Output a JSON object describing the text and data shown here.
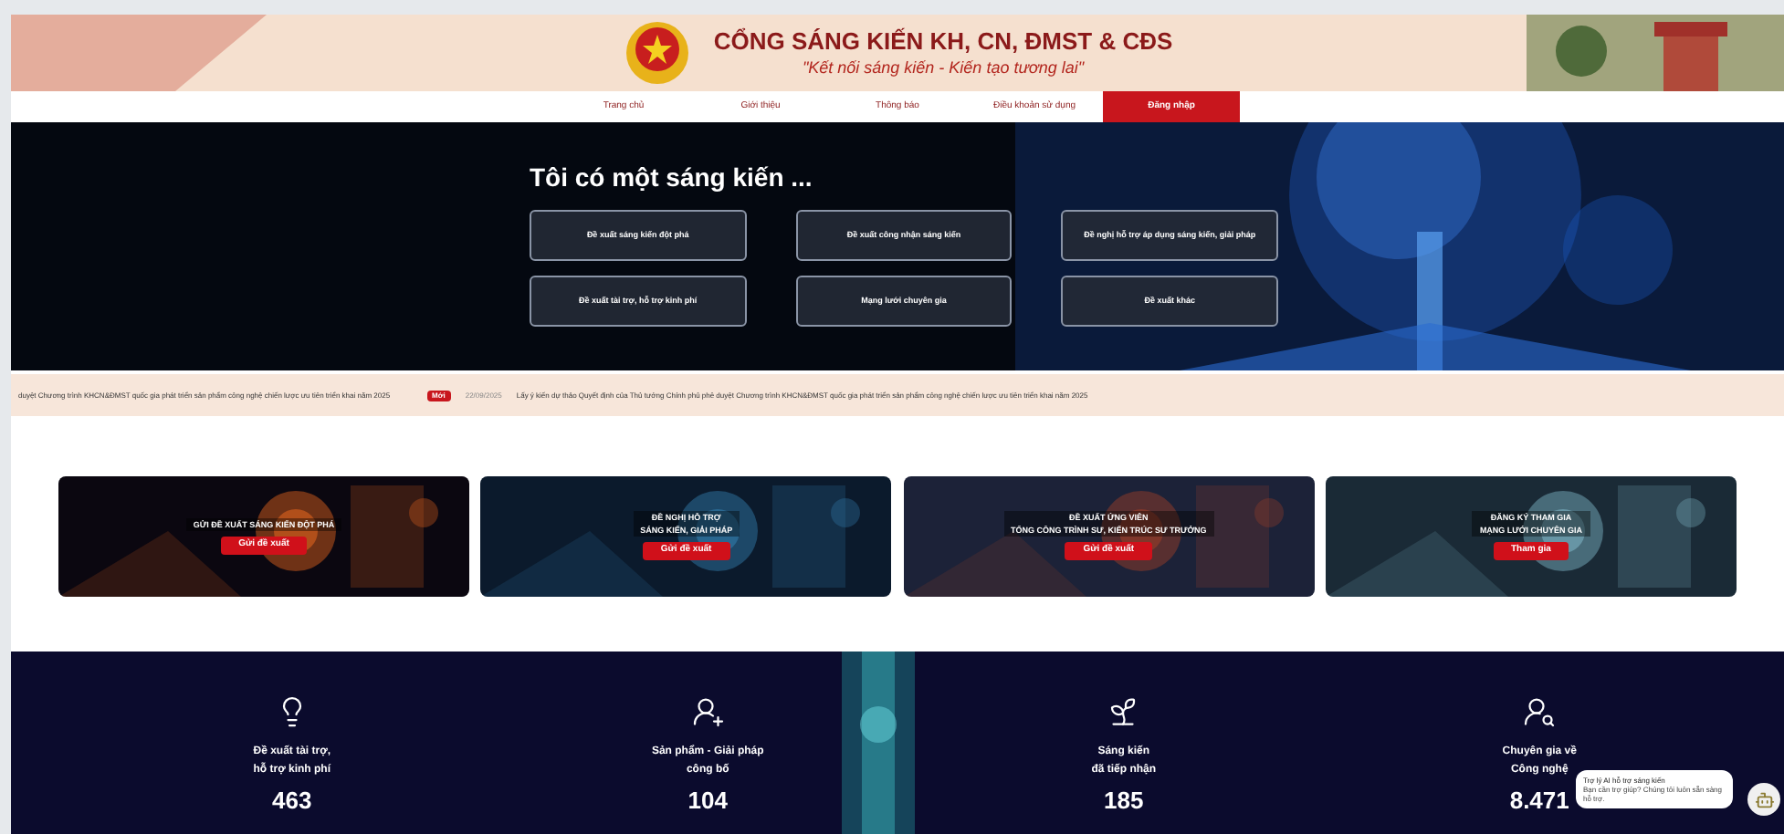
{
  "header": {
    "title": "CỔNG SÁNG KIẾN KH, CN, ĐMST & CĐS",
    "slogan": "\"Kết nối sáng kiến - Kiến tạo tương lai\""
  },
  "nav": [
    {
      "label": "Trang chủ",
      "selected": false
    },
    {
      "label": "Giới thiệu",
      "selected": false
    },
    {
      "label": "Thông báo",
      "selected": false
    },
    {
      "label": "Điều khoản sử dụng",
      "selected": false
    },
    {
      "label": "Đăng nhập",
      "selected": true
    }
  ],
  "hero": {
    "title": "Tôi có một sáng kiến ...",
    "options": [
      "Đề xuất sáng kiến đột phá",
      "Đề xuất công nhận sáng kiến",
      "Đề nghị hỗ trợ áp dụng sáng kiến, giải pháp",
      "Đề xuất tài trợ, hỗ trợ kinh phí",
      "Mạng lưới chuyên gia",
      "Đề xuất khác"
    ]
  },
  "ticker": {
    "previous": "duyệt Chương trình KHCN&ĐMST quốc gia phát triển sản phẩm công nghệ chiến lược ưu tiên triển khai năm 2025",
    "badge": "Mới",
    "date": "22/09/2025",
    "text": "Lấy ý kiến dự thảo Quyết định của Thủ tướng Chính phủ phê duyệt Chương trình KHCN&ĐMST quốc gia phát triển sản phẩm công nghệ chiến lược ưu tiên triển khai năm 2025"
  },
  "cards": [
    {
      "lines": [
        "GỬI ĐỀ XUẤT SÁNG KIẾN ĐỘT PHÁ"
      ],
      "button": "Gửi đề xuất",
      "kind": "card"
    },
    {
      "lines": [
        "ĐỀ NGHỊ HỖ TRỢ",
        "SÁNG KIẾN, GIẢI PHÁP"
      ],
      "button": "Gửi đề xuất",
      "kind": "card"
    },
    {
      "lines": [
        "ĐỀ XUẤT ỨNG VIÊN",
        "TỔNG CÔNG TRÌNH SƯ, KIẾN TRÚC SƯ TRƯỞNG"
      ],
      "button": "Gửi đề xuất",
      "kind": "card"
    },
    {
      "lines": [
        "ĐĂNG KÝ THAM GIA",
        "MẠNG LƯỚI CHUYÊN GIA"
      ],
      "button": "Tham gia",
      "kind": "card"
    }
  ],
  "stats": [
    {
      "lines": [
        "Đề xuất tài trợ,",
        "hỗ trợ kinh phí"
      ],
      "value": "463"
    },
    {
      "lines": [
        "Sản phẩm - Giải pháp",
        "công bố"
      ],
      "value": "104"
    },
    {
      "lines": [
        "Sáng kiến",
        "đã tiếp nhận"
      ],
      "value": "185"
    },
    {
      "lines": [
        "Chuyên gia về",
        "Công nghệ"
      ],
      "value": "8.471"
    }
  ],
  "chat": {
    "title": "Trợ lý AI hỗ trợ sáng kiến",
    "text": "Bạn cần trợ giúp? Chúng tôi luôn sẵn sàng hỗ trợ."
  }
}
